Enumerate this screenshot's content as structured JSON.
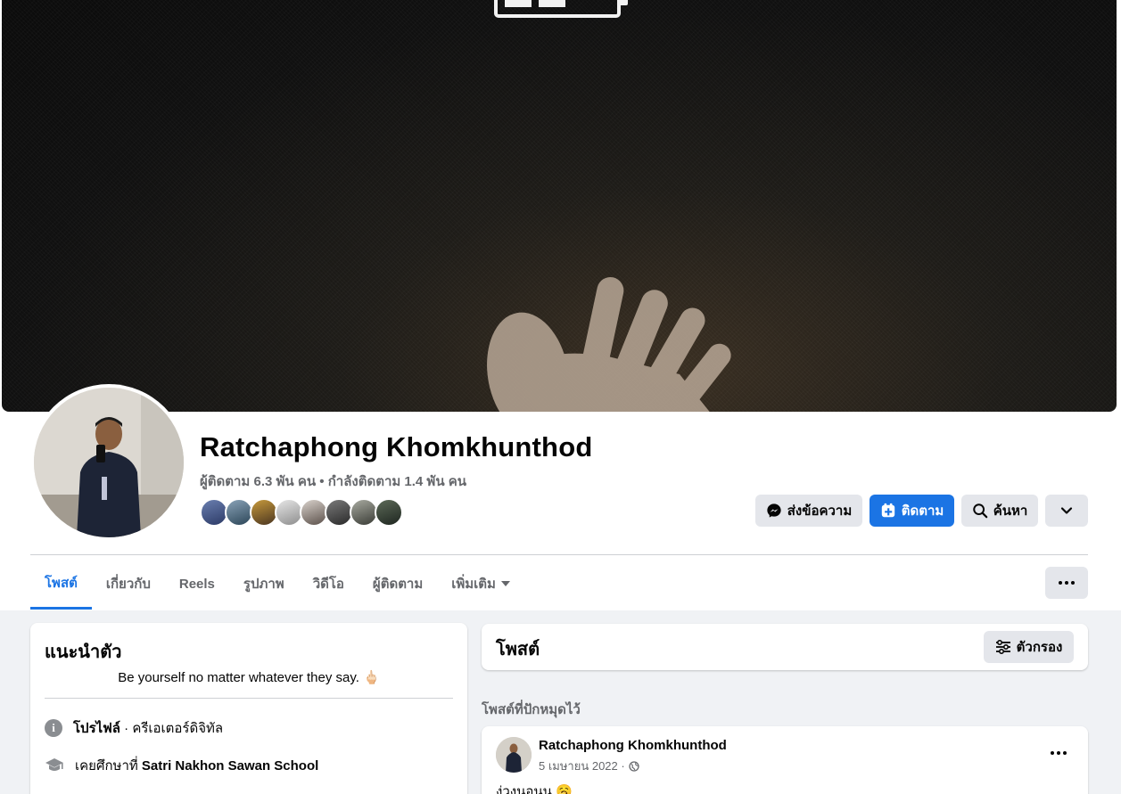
{
  "profile": {
    "name": "Ratchaphong Khomkhunthod",
    "stats": "ผู้ติดตาม 6.3 พัน คน • กำลังติดตาม 1.4 พัน คน"
  },
  "actions": {
    "message": "ส่งข้อความ",
    "follow": "ติดตาม",
    "search": "ค้นหา"
  },
  "tabs": [
    {
      "label": "โพสต์"
    },
    {
      "label": "เกี่ยวกับ"
    },
    {
      "label": "Reels"
    },
    {
      "label": "รูปภาพ"
    },
    {
      "label": "วิดีโอ"
    },
    {
      "label": "ผู้ติดตาม"
    },
    {
      "label": "เพิ่มเติม"
    }
  ],
  "intro": {
    "title": "แนะนำตัว",
    "bio": "Be yourself no matter whatever they say. 🖕🏻",
    "profile_label": "โปรไฟล์",
    "profile_category": " · ครีเอเตอร์ดิจิทัล",
    "school_prefix": "เคยศึกษาที่ ",
    "school_name": "Satri Nakhon Sawan School"
  },
  "posts": {
    "title": "โพสต์",
    "filter_label": "ตัวกรอง",
    "pinned_label": "โพสต์ที่ปักหมุดไว้",
    "pinned_post": {
      "author": "Ratchaphong Khomkhunthod",
      "date": "5 เมษายน 2022 ·",
      "text": "ง่วงนอนน 🥱"
    }
  },
  "colors": {
    "accent": "#1b74e4",
    "background": "#f0f2f5",
    "secondary_text": "#65676b"
  },
  "icons": [
    "messenger-icon",
    "follow-plus-icon",
    "search-icon",
    "chevron-down-icon",
    "more-dots-icon",
    "filter-icon",
    "info-icon",
    "graduation-cap-icon",
    "globe-icon"
  ]
}
